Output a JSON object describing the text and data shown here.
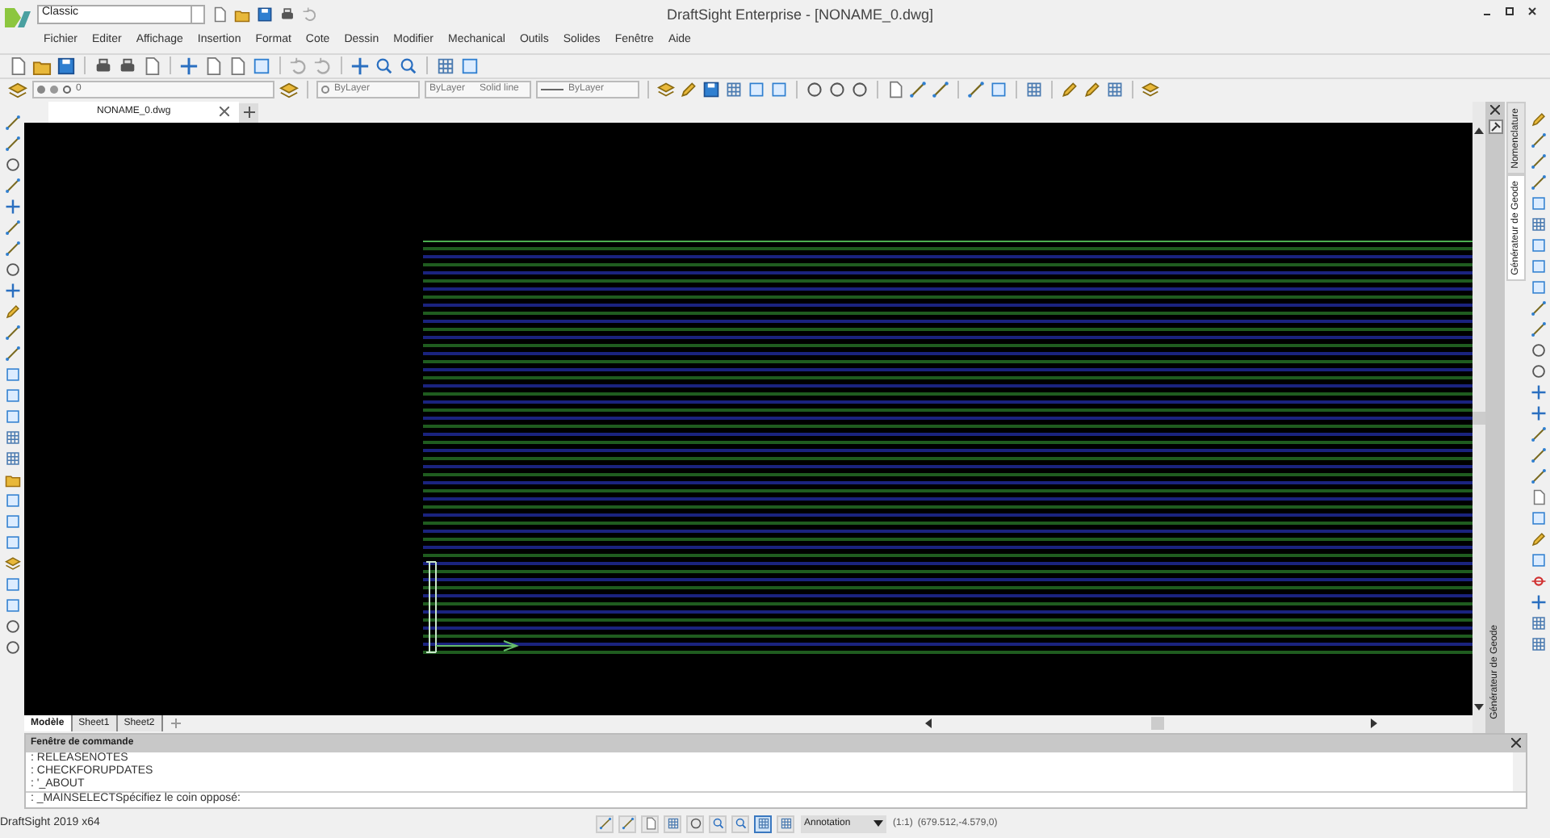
{
  "title_bar": {
    "workspace": "Classic",
    "title": "DraftSight Enterprise - [NONAME_0.dwg]"
  },
  "menu": [
    "Fichier",
    "Editer",
    "Affichage",
    "Insertion",
    "Format",
    "Cote",
    "Dessin",
    "Modifier",
    "Mechanical",
    "Outils",
    "Solides",
    "Fenêtre",
    "Aide"
  ],
  "layer_combo": {
    "value": "0"
  },
  "property_combos": [
    {
      "kind": "color",
      "value": "ByLayer"
    },
    {
      "kind": "linetype",
      "value": "ByLayer",
      "detail": "Solid line"
    },
    {
      "kind": "lineweight",
      "value": "ByLayer"
    }
  ],
  "document_tabs": [
    {
      "label": "NONAME_0.dwg",
      "selected": true
    }
  ],
  "side_panel": {
    "title": "Générateur de Geode",
    "tabs": [
      {
        "label": "Nomenclature",
        "selected": false
      },
      {
        "label": "Générateur de Geode",
        "selected": true
      }
    ]
  },
  "layout_tabs": [
    {
      "label": "Modèle",
      "selected": true
    },
    {
      "label": "Sheet1",
      "selected": false
    },
    {
      "label": "Sheet2",
      "selected": false
    }
  ],
  "command_window": {
    "title": "Fenêtre de commande",
    "history": [
      ": RELEASENOTES",
      ": CHECKFORUPDATES",
      ": '_ABOUT"
    ],
    "prompt": ": _MAINSELECTSpécifiez le coin opposé:"
  },
  "status_bar": {
    "app": "DraftSight 2019 x64",
    "toggles": [
      {
        "on": false
      },
      {
        "on": false
      },
      {
        "on": false
      },
      {
        "on": false
      },
      {
        "on": false
      },
      {
        "on": false
      },
      {
        "on": false
      },
      {
        "on": true
      },
      {
        "on": false
      }
    ],
    "annotation": "Annotation",
    "scale": "(1:1)",
    "coordinates": "(679.512,-4.579,0)"
  }
}
